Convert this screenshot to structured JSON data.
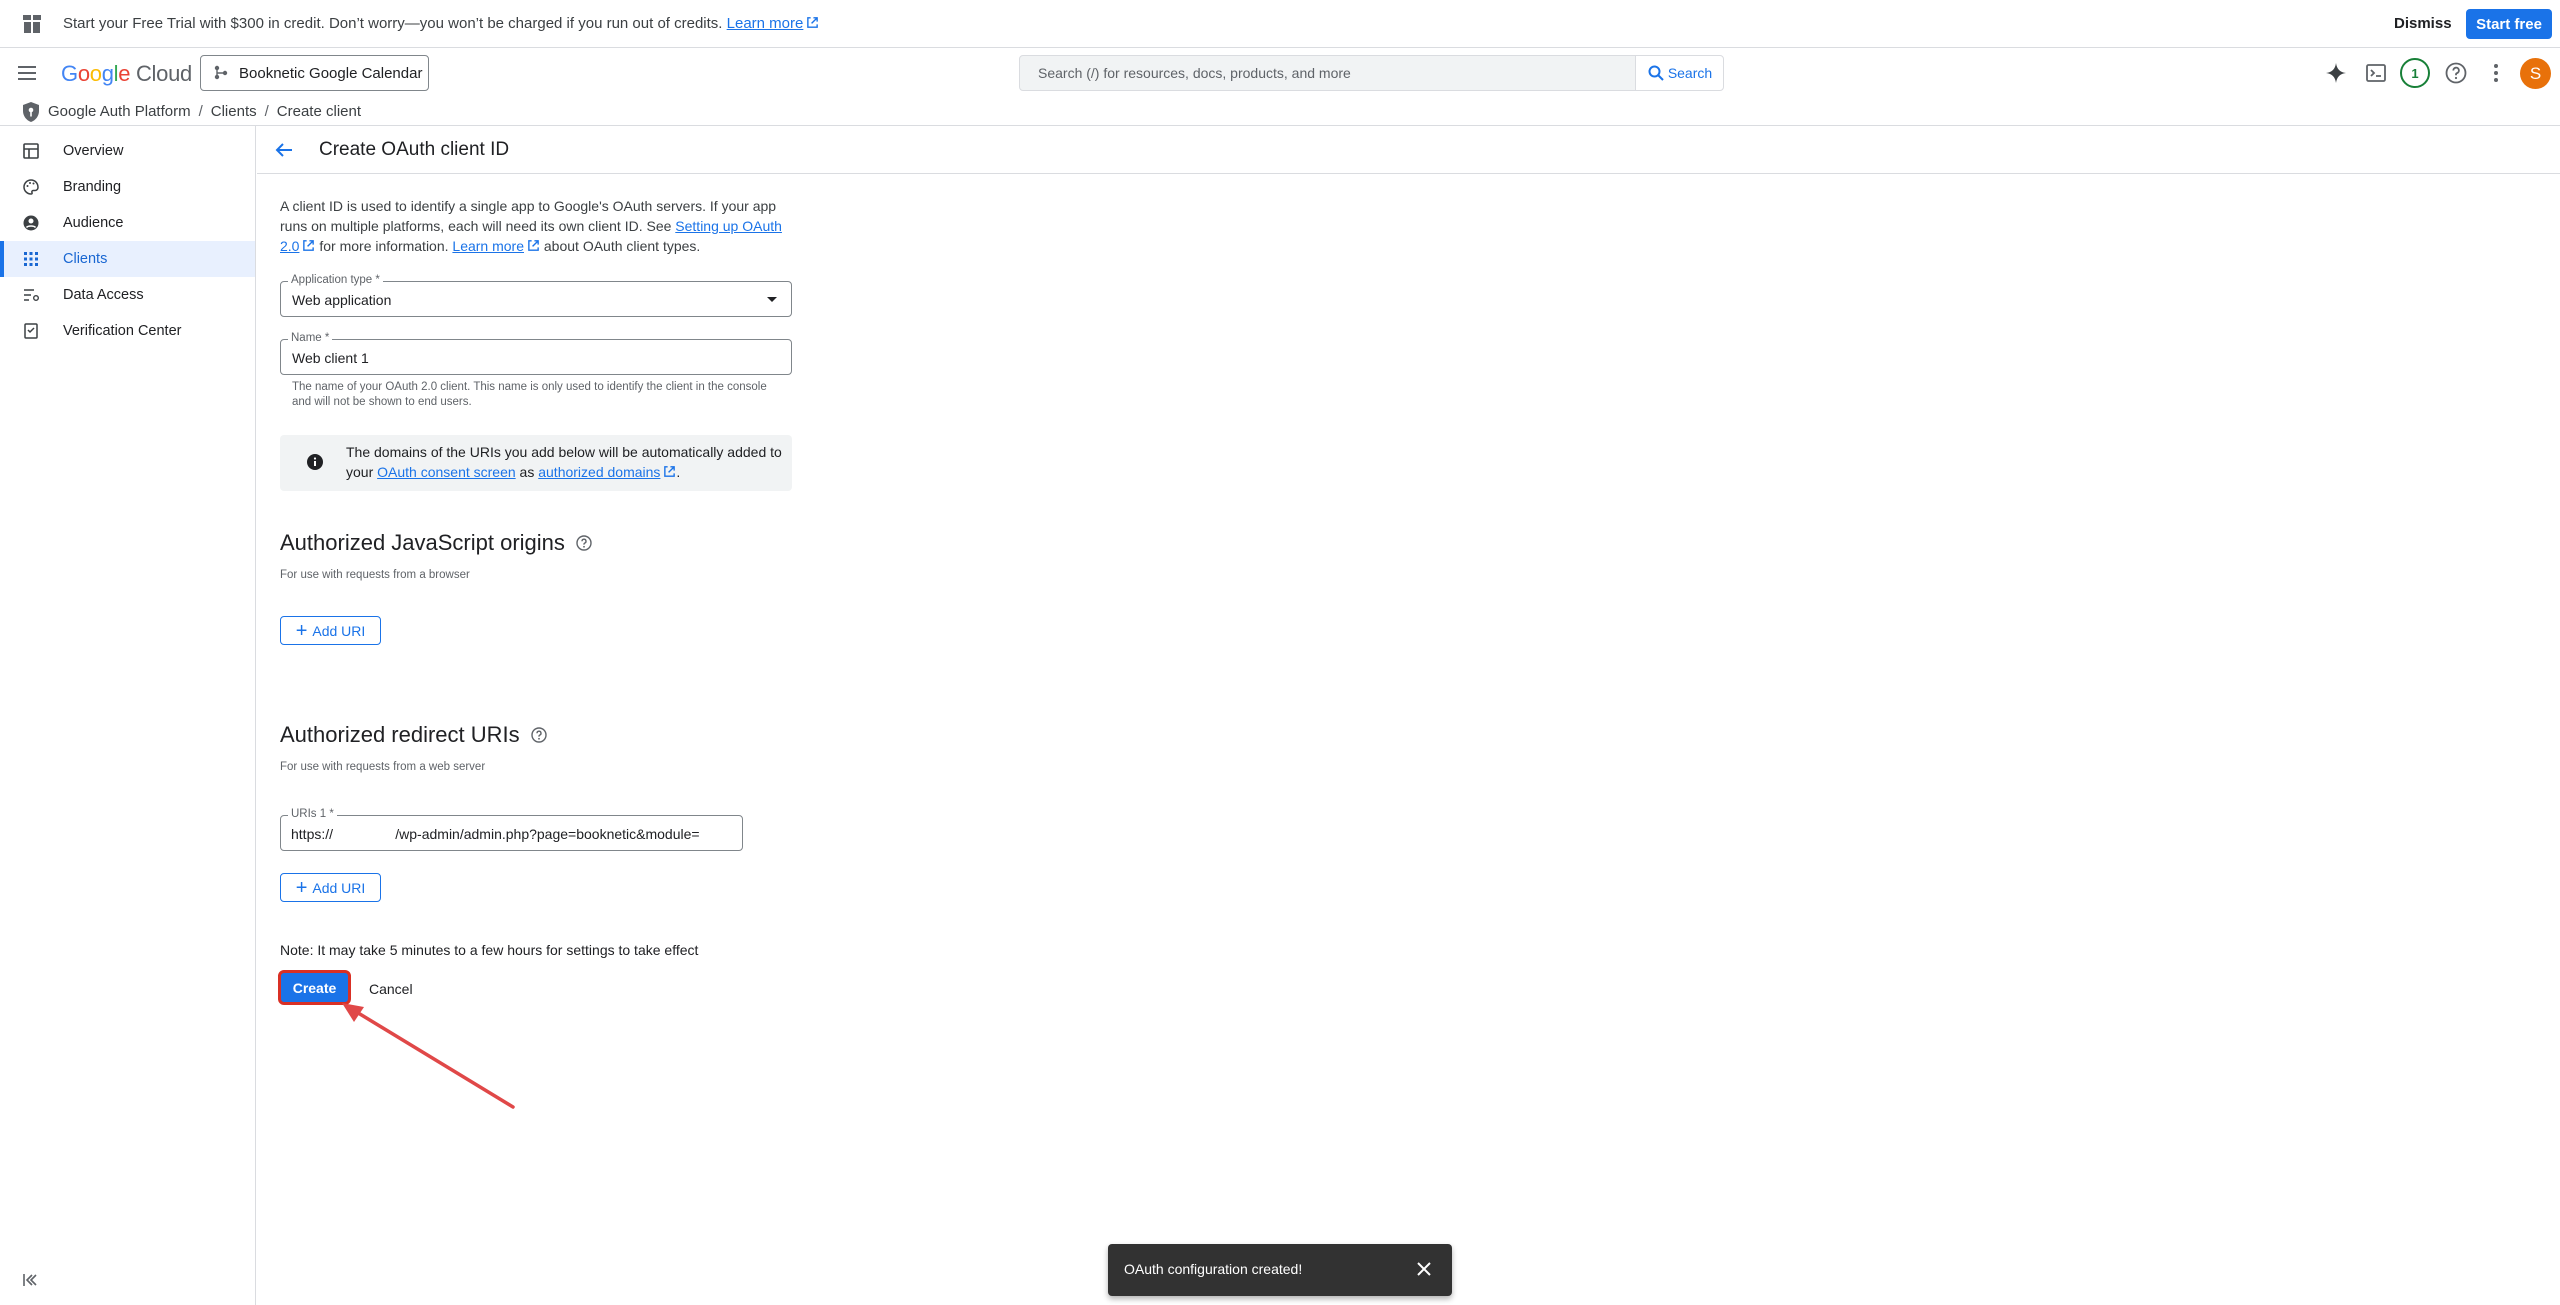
{
  "promo": {
    "message": "Start your Free Trial with $300 in credit. Don’t worry—you won’t be charged if you run out of credits.",
    "learn_more": "Learn more",
    "dismiss": "Dismiss",
    "start_free": "Start free"
  },
  "topnav": {
    "logo_parts": [
      "G",
      "o",
      "o",
      "g",
      "l",
      "e"
    ],
    "logo_cloud": "Cloud",
    "project": "Booknetic Google Calendar",
    "search_placeholder": "Search (/) for resources, docs, products, and more",
    "search_button": "Search",
    "notification_count": "1",
    "avatar_initial": "S"
  },
  "breadcrumb": {
    "items": [
      "Google Auth Platform",
      "Clients",
      "Create client"
    ],
    "separator": "/"
  },
  "sidebar": {
    "items": [
      {
        "label": "Overview",
        "icon": "dashboard-icon"
      },
      {
        "label": "Branding",
        "icon": "palette-icon"
      },
      {
        "label": "Audience",
        "icon": "account-circle-icon"
      },
      {
        "label": "Clients",
        "icon": "apps-grid-icon",
        "active": true
      },
      {
        "label": "Data Access",
        "icon": "filter-list-icon"
      },
      {
        "label": "Verification Center",
        "icon": "checklist-icon"
      }
    ]
  },
  "page": {
    "title": "Create OAuth client ID",
    "intro_1": "A client ID is used to identify a single app to Google's OAuth servers. If your app runs on multiple platforms, each will need its own client ID. See ",
    "intro_link_1": "Setting up OAuth 2.0",
    "intro_2": " for more information. ",
    "intro_link_2": "Learn more",
    "intro_3": " about OAuth client types.",
    "app_type_label": "Application type *",
    "app_type_value": "Web application",
    "name_label": "Name *",
    "name_value": "Web client 1",
    "name_hint": "The name of your OAuth 2.0 client. This name is only used to identify the client in the console and will not be shown to end users.",
    "info_1": "The domains of the URIs you add below will be automatically added to your ",
    "info_link_1": "OAuth consent screen",
    "info_2": " as ",
    "info_link_2": "authorized domains",
    "info_3": ".",
    "js_origins_title": "Authorized JavaScript origins",
    "js_origins_sub": "For use with requests from a browser",
    "add_uri": "Add URI",
    "redirect_title": "Authorized redirect URIs",
    "redirect_sub": "For use with requests from a web server",
    "uri_label": "URIs 1 *",
    "uri_value": "https://                /wp-admin/admin.php?page=booknetic&module=",
    "note": "Note: It may take 5 minutes to a few hours for settings to take effect",
    "create": "Create",
    "cancel": "Cancel"
  },
  "snackbar": {
    "message": "OAuth configuration created!"
  },
  "colors": {
    "accent": "#1a73e8",
    "highlight": "#d93025",
    "snackbar_bg": "#323232"
  }
}
